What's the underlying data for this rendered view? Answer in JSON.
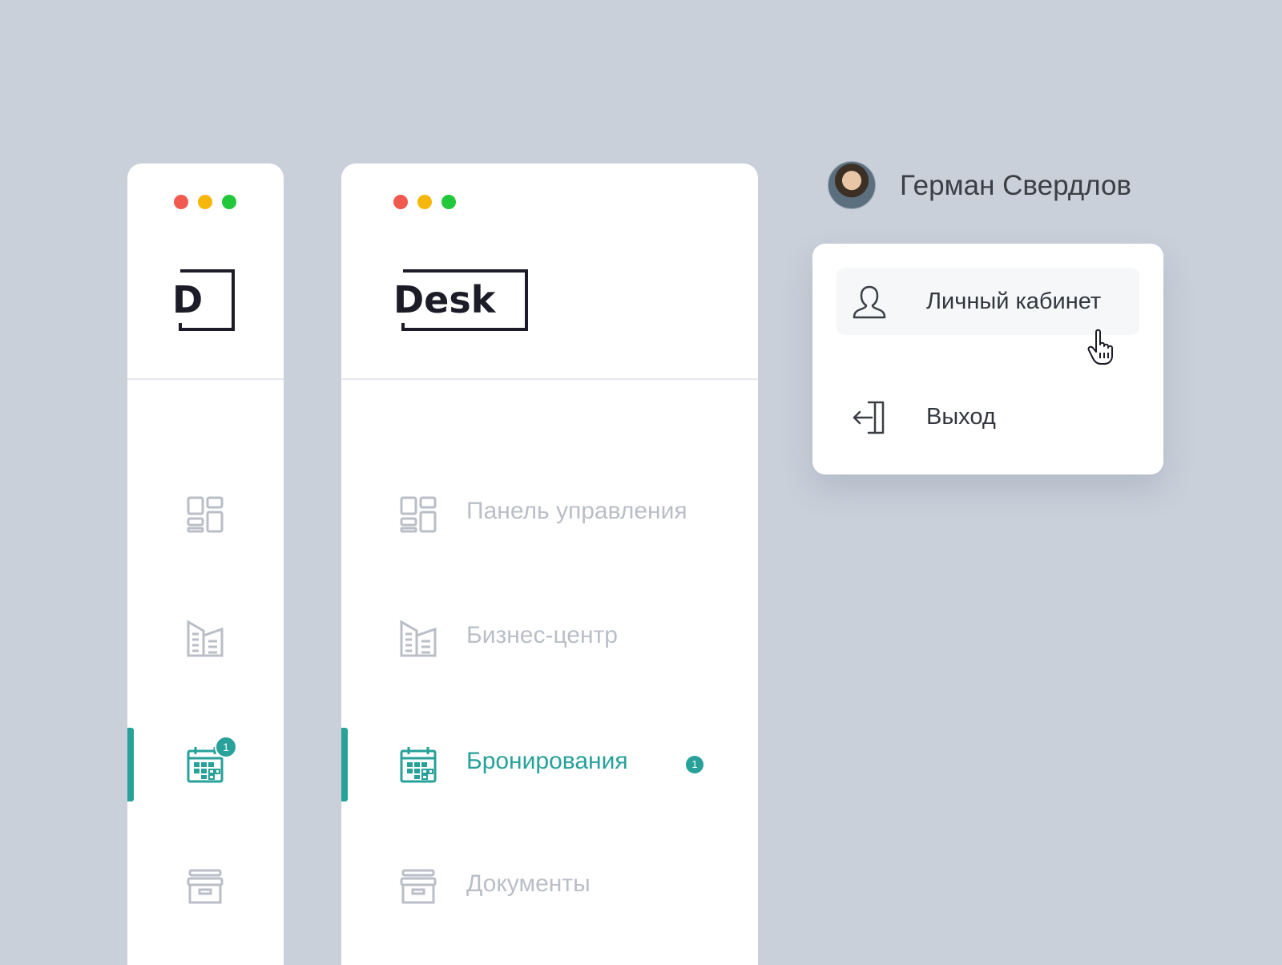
{
  "window_controls": {
    "close_color": "#f05a4f",
    "minimize_color": "#f6b60a",
    "maximize_color": "#20c83a"
  },
  "collapsed_sidebar": {
    "logo_text": "D",
    "nav": [
      {
        "icon": "dashboard-icon",
        "active": false
      },
      {
        "icon": "business-center-icon",
        "active": false
      },
      {
        "icon": "calendar-icon",
        "active": true,
        "badge": "1"
      },
      {
        "icon": "archive-icon",
        "active": false
      }
    ]
  },
  "expanded_sidebar": {
    "logo_text": "Desk",
    "nav": [
      {
        "label": "Панель управления",
        "icon": "dashboard-icon",
        "active": false
      },
      {
        "label": "Бизнес-центр",
        "icon": "business-center-icon",
        "active": false
      },
      {
        "label": "Бронирования",
        "icon": "calendar-icon",
        "active": true,
        "badge": "1"
      },
      {
        "label": "Документы",
        "icon": "archive-icon",
        "active": false
      }
    ]
  },
  "user": {
    "name": "Герман Свердлов"
  },
  "dropdown": {
    "items": [
      {
        "label": "Личный кабинет",
        "icon": "user-icon",
        "hovered": true
      },
      {
        "label": "Выход",
        "icon": "logout-icon",
        "hovered": false
      }
    ]
  },
  "colors": {
    "accent": "#27a19a",
    "muted": "#b9bec7",
    "background": "#c9d0da"
  }
}
